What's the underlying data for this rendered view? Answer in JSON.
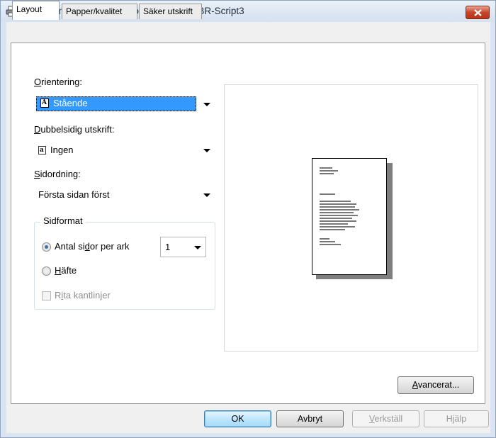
{
  "window": {
    "title": "Utskriftsinställningar för Brother HL- xxxx BR-Script3"
  },
  "tabs": [
    {
      "label": "Layout",
      "active": true
    },
    {
      "label": "Papper/kvalitet",
      "active": false
    },
    {
      "label": "Säker utskrift",
      "active": false
    }
  ],
  "orientation": {
    "label_first": "O",
    "label_rest": "rientering:",
    "value": "Stående"
  },
  "duplex": {
    "label_first": "D",
    "label_rest": "ubbelsidig utskrift:",
    "value": "Ingen"
  },
  "page_order": {
    "label_first": "S",
    "label_rest": "idordning:",
    "value": "Första sidan först"
  },
  "page_format": {
    "group_label": "Sidformat",
    "pages_per_sheet_pre": "Antal si",
    "pages_per_sheet_u": "d",
    "pages_per_sheet_post": "or per ark",
    "pages_per_sheet_value": "1",
    "pages_per_sheet_selected": true,
    "booklet_u": "H",
    "booklet_rest": "äfte",
    "booklet_selected": false,
    "borders_pre": "R",
    "borders_u": "i",
    "borders_post": "ta kantlinjer",
    "borders_checked": false
  },
  "buttons": {
    "advanced_u": "A",
    "advanced_rest": "vancerat...",
    "ok": "OK",
    "cancel": "Avbryt",
    "apply_u": "V",
    "apply_rest": "erkställ",
    "help": "Hjälp"
  },
  "colors": {
    "selection": "#3399ff",
    "default_button": "#bee6fd",
    "close_button": "#c7452a"
  }
}
